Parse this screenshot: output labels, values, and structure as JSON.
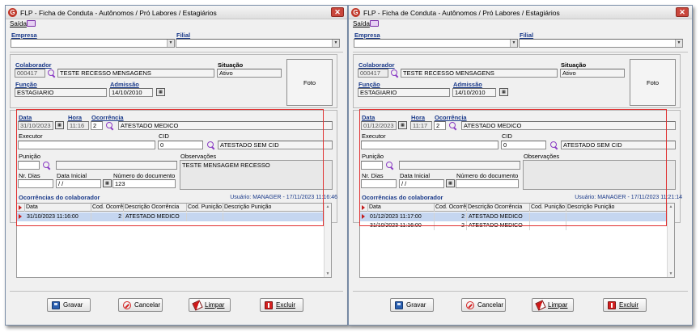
{
  "windows": [
    {
      "title": "FLP - Ficha de Conduta - Autônomos / Pró Labores / Estagiários",
      "menu": {
        "saida": "Saída"
      },
      "labels": {
        "empresa": "Empresa",
        "filial": "Filial",
        "colaborador": "Colaborador",
        "situacao": "Situação",
        "funcao": "Função",
        "admissao": "Admissão",
        "foto": "Foto",
        "data": "Data",
        "hora": "Hora",
        "ocorrencia": "Ocorrência",
        "executor": "Executor",
        "cid": "CID",
        "punicao": "Punição",
        "observacoes": "Observações",
        "nr_dias": "Nr. Dias",
        "data_inicial": "Data Inicial",
        "numero_documento": "Número do documento",
        "ocorrencias_colaborador": "Ocorrências do colaborador"
      },
      "values": {
        "colaborador_code": "000417",
        "colaborador_name": "TESTE RECESSO MENSAGENS",
        "situacao": "Ativo",
        "funcao": "ESTAGIARIO",
        "admissao": "14/10/2010",
        "data": "31/10/2023",
        "hora": "11:16",
        "ocorrencia_code": "2",
        "ocorrencia_desc": "ATESTADO MEDICO",
        "cid_code": "0",
        "cid_desc": "ATESTADO SEM CID",
        "observacoes": "TESTE MENSAGEM RECESSO",
        "data_inicial": " / / ",
        "numero_documento": "123"
      },
      "user_info": "Usuário: MANAGER - 17/11/2023 11:16:46",
      "grid": {
        "columns": [
          "Data",
          "Cod. Ocorrência",
          "Descrição Ocorrência",
          "Cod. Punição",
          "Descrição Punição"
        ],
        "rows": [
          {
            "data": "31/10/2023 11:16:00",
            "cod": "2",
            "desc": "ATESTADO MEDICO",
            "cod_p": "",
            "desc_p": "",
            "selected": true
          }
        ]
      },
      "buttons": {
        "gravar": "Gravar",
        "cancelar": "Cancelar",
        "limpar": "Limpar",
        "excluir": "Excluir"
      }
    },
    {
      "title": "FLP - Ficha de Conduta - Autônomos / Pró Labores / Estagiários",
      "menu": {
        "saida": "Saída"
      },
      "labels": {
        "empresa": "Empresa",
        "filial": "Filial",
        "colaborador": "Colaborador",
        "situacao": "Situação",
        "funcao": "Função",
        "admissao": "Admissão",
        "foto": "Foto",
        "data": "Data",
        "hora": "Hora",
        "ocorrencia": "Ocorrência",
        "executor": "Executor",
        "cid": "CID",
        "punicao": "Punição",
        "observacoes": "Observações",
        "nr_dias": "Nr. Dias",
        "data_inicial": "Data Inicial",
        "numero_documento": "Número do documento",
        "ocorrencias_colaborador": "Ocorrências do colaborador"
      },
      "values": {
        "colaborador_code": "000417",
        "colaborador_name": "TESTE RECESSO MENSAGENS",
        "situacao": "Ativo",
        "funcao": "ESTAGIARIO",
        "admissao": "14/10/2010",
        "data": "01/12/2023",
        "hora": "11:17",
        "ocorrencia_code": "2",
        "ocorrencia_desc": "ATESTADO MEDICO",
        "cid_code": "0",
        "cid_desc": "ATESTADO SEM CID",
        "observacoes": "",
        "data_inicial": " / / ",
        "numero_documento": ""
      },
      "user_info": "Usuário: MANAGER - 17/11/2023 11:21:14",
      "grid": {
        "columns": [
          "Data",
          "Cod. Ocorrência",
          "Descrição Ocorrência",
          "Cod. Punição",
          "Descrição Punição"
        ],
        "rows": [
          {
            "data": "01/12/2023 11:17:00",
            "cod": "2",
            "desc": "ATESTADO MEDICO",
            "cod_p": "",
            "desc_p": "",
            "selected": true
          },
          {
            "data": "31/10/2023 11:16:00",
            "cod": "2",
            "desc": "ATESTADO MEDICO",
            "cod_p": "",
            "desc_p": "",
            "selected": false
          }
        ]
      },
      "buttons": {
        "gravar": "Gravar",
        "cancelar": "Cancelar",
        "limpar": "Limpar",
        "excluir": "Excluir"
      }
    }
  ],
  "colors": {
    "highlight_box": "#e03030",
    "label_blue": "#1a3a8a",
    "selected_row": "#c5d6f0"
  }
}
